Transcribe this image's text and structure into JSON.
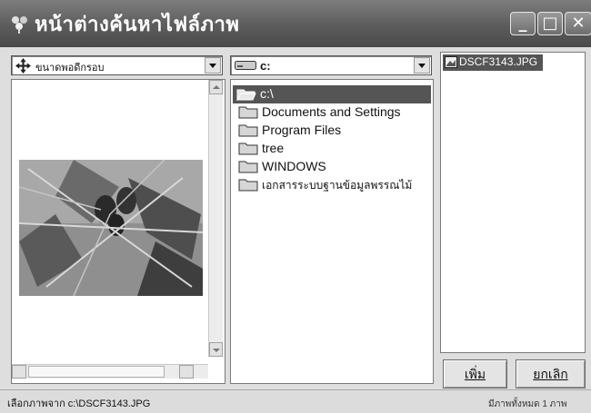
{
  "window": {
    "title": "หน้าต่างค้นหาไฟล์ภาพ"
  },
  "title_buttons": {
    "minimize": "_",
    "maximize": "□",
    "close": "✕"
  },
  "size_combo": {
    "value": "ขนาดพอดีกรอบ",
    "icon": "move-arrows-icon"
  },
  "drive_combo": {
    "value": "c:",
    "icon": "drive-icon"
  },
  "folders": [
    {
      "label": "c:\\",
      "selected": true,
      "icon": "open-folder-icon"
    },
    {
      "label": "Documents and Settings",
      "selected": false,
      "icon": "folder-icon"
    },
    {
      "label": "Program Files",
      "selected": false,
      "icon": "folder-icon"
    },
    {
      "label": "tree",
      "selected": false,
      "icon": "folder-icon"
    },
    {
      "label": "WINDOWS",
      "selected": false,
      "icon": "folder-icon"
    },
    {
      "label": "เอกสารระบบฐานข้อมูลพรรณไม้",
      "selected": false,
      "icon": "folder-icon"
    }
  ],
  "files": [
    {
      "label": "DSCF3143.JPG",
      "selected": true,
      "icon": "image-file-icon"
    }
  ],
  "buttons": {
    "add": "เพิ่ม",
    "cancel": "ยกเลิก"
  },
  "status": {
    "left": "เลือกภาพจาก c:\\DSCF3143.JPG",
    "right": "มีภาพทั้งหมด 1 ภาพ"
  },
  "colors": {
    "titlebar": "#5c5c5c",
    "selection": "#555555"
  }
}
